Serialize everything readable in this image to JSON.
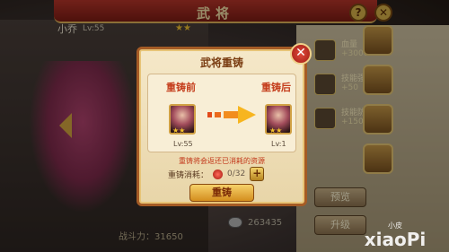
{
  "screen": {
    "title": "武将",
    "help_label": "?",
    "close_label": "✕"
  },
  "hero": {
    "name": "小乔",
    "level": "Lv:55",
    "stars": "★★",
    "power": "战斗力：31650"
  },
  "stats": [
    {
      "name": "血量",
      "value": "+3000"
    },
    {
      "name": "技能强度",
      "value": "+50"
    },
    {
      "name": "技能防御",
      "value": "+150"
    }
  ],
  "buttons": {
    "preview": "预览",
    "upgrade": "升级"
  },
  "currency": {
    "silver": "263435"
  },
  "dialog": {
    "title": "武将重铸",
    "close": "✕",
    "before_label": "重铸前",
    "after_label": "重铸后",
    "before_level": "Lv:55",
    "after_level": "Lv:1",
    "before_stars": "★★",
    "after_stars": "★★",
    "warning": "重铸将会返还已消耗的资源",
    "cost_label": "重铸消耗：",
    "cost_count": "0/32",
    "plus": "+",
    "confirm": "重铸"
  },
  "watermark": {
    "small": "小皮",
    "brand": "xiaoPi"
  },
  "colors": {
    "accent": "#c43c1b",
    "gold": "#e7c477"
  }
}
